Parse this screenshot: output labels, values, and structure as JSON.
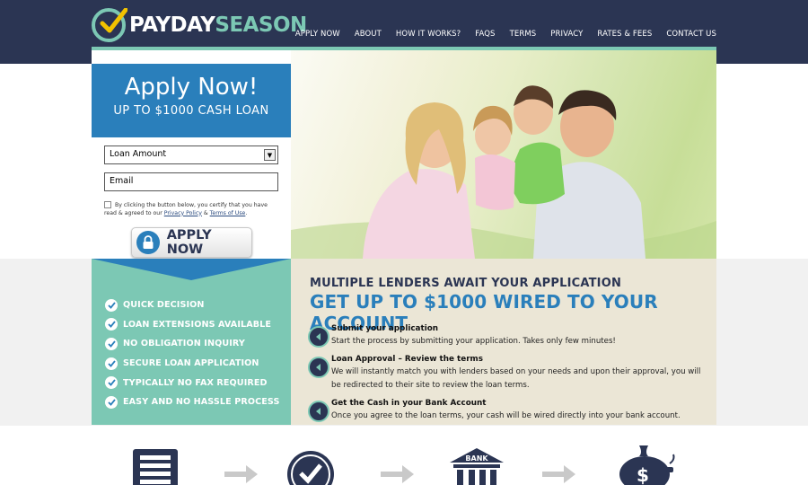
{
  "brand": {
    "name_part1": "PAYDAY",
    "name_part2": "SEASON",
    "colors": {
      "navy": "#2b3553",
      "teal": "#7cc8b4",
      "blue": "#2a7fbb",
      "beige": "#ebe6d6"
    }
  },
  "nav": {
    "items": [
      "APPLY NOW",
      "ABOUT",
      "HOW IT WORKS?",
      "FAQS",
      "TERMS",
      "PRIVACY",
      "RATES & FEES",
      "CONTACT US"
    ]
  },
  "form": {
    "title": "Apply Now!",
    "subtitle": "UP TO $1000 CASH LOAN",
    "loan_amount_value": "Loan Amount",
    "email_placeholder": "Email",
    "consent_prefix": "By clicking the button below, you certify that you have read & agreed to our",
    "privacy_link": "Privacy Policy",
    "amp": "&",
    "terms_link": "Terms of Use",
    "period": ".",
    "apply_button": "APPLY NOW"
  },
  "benefits": [
    "QUICK DECISION",
    "LOAN EXTENSIONS AVAILABLE",
    "NO OBLIGATION INQUIRY",
    "SECURE LOAN APPLICATION",
    "TYPICALLY NO FAX REQUIRED",
    "EASY AND NO HASSLE PROCESS"
  ],
  "steps": {
    "heading1": "MULTIPLE LENDERS AWAIT YOUR APPLICATION",
    "heading2": "GET UP TO $1000 WIRED TO YOUR ACCOUNT",
    "items": [
      {
        "title": "Submit your application",
        "desc": "Start the process by submitting your application. Takes only few minutes!"
      },
      {
        "title": "Loan Approval – Review the terms",
        "desc": "We will instantly match you with lenders based on your needs and upon their approval, you will be redirected to their site to review the loan terms."
      },
      {
        "title": "Get the Cash in your Bank Account",
        "desc": "Once you agree to the loan terms, your cash will be wired directly into your bank account."
      }
    ]
  },
  "bottom_icons": {
    "bank_label": "BANK",
    "icons": [
      "form-icon",
      "checkmark-icon",
      "bank-icon",
      "piggy-bank-icon"
    ]
  }
}
